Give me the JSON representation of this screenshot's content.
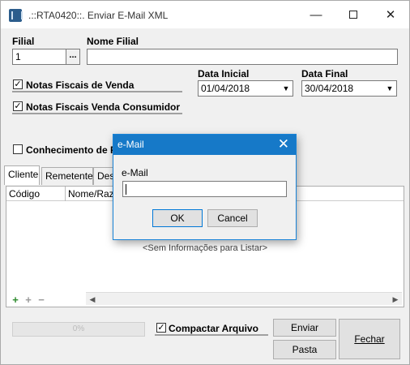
{
  "window": {
    "title": ".::RTA0420::. Enviar E-Mail XML"
  },
  "form": {
    "filial_label": "Filial",
    "filial_value": "1",
    "nome_filial_label": "Nome Filial",
    "nome_filial_value": "",
    "data_inicial_label": "Data Inicial",
    "data_inicial_value": "01/04/2018",
    "data_final_label": "Data Final",
    "data_final_value": "30/04/2018",
    "ellipsis": "..."
  },
  "checkboxes": [
    {
      "label": "Notas Fiscais de Venda",
      "checked": true
    },
    {
      "label": "Notas Fiscais Venda Consumidor",
      "checked": true
    },
    {
      "label": "Conhecimento de F",
      "checked": false
    }
  ],
  "tabs": [
    {
      "label": "Cliente",
      "active": true
    },
    {
      "label": "Remetente",
      "active": false
    },
    {
      "label": "Des",
      "active": false
    }
  ],
  "grid": {
    "columns": [
      "Código",
      "Nome/Razã"
    ],
    "empty_message": "<Sem Informações para Listar>",
    "nav_add": "+",
    "nav_add_multi": "+",
    "nav_remove": "−"
  },
  "bottom": {
    "progress_text": "0%",
    "progress_value": 0,
    "compactar_label": "Compactar Arquivo",
    "compactar_checked": true,
    "enviar_label": "Enviar",
    "pasta_label": "Pasta",
    "fechar_label": "Fechar"
  },
  "dialog": {
    "title": "e-Mail",
    "field_label": "e-Mail",
    "field_value": "",
    "ok_label": "OK",
    "cancel_label": "Cancel"
  },
  "colors": {
    "dialog_title_bg": "#1679c8",
    "window_bg": "#f0f0f0"
  }
}
